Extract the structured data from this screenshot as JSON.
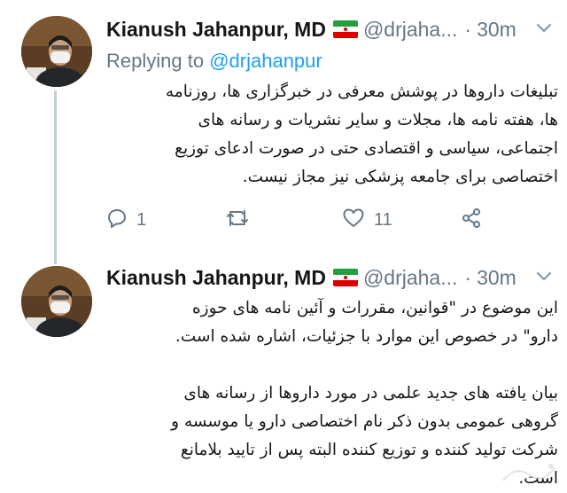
{
  "tweets": [
    {
      "author": {
        "name": "Kianush Jahanpur, MD",
        "handle": "@drjaha...",
        "flag": "iran-flag"
      },
      "time": "30m",
      "reply_label": "Replying to",
      "reply_mention": "@drjahanpur",
      "lines": [
        "تبلیغات داروها در پوشش معرفی در خبرگزاری ها، روزنامه",
        "ها، هفته نامه ها، مجلات و سایر نشریات و رسانه های",
        "اجتماعی، سیاسی و اقتصادی حتی در صورت ادعای توزیع",
        "اختصاصی برای جامعه پزشکی نیز مجاز نیست."
      ],
      "actions": {
        "reply_count": "1",
        "retweet_count": "",
        "like_count": "11"
      }
    },
    {
      "author": {
        "name": "Kianush Jahanpur, MD",
        "handle": "@drjaha...",
        "flag": "iran-flag"
      },
      "time": "30m",
      "para1": [
        "این موضوع در \"قوانین، مقررات و آئین نامه های حوزه",
        "دارو\" در خصوص این موارد با جزئیات، اشاره شده است."
      ],
      "para2": [
        "بیان یافته های جدید علمی در مورد داروها از رسانه های",
        "گروهی عمومی بدون ذکر نام اختصاصی دارو یا موسسه و",
        "شرکت تولید کننده و توزیع کننده البته  پس از تایید بلامانع",
        "است."
      ]
    }
  ],
  "icons": {
    "reply": "reply-icon",
    "retweet": "retweet-icon",
    "like": "heart-icon",
    "share": "share-icon",
    "more": "chevron-down-icon"
  },
  "colors": {
    "link": "#1da1f2",
    "secondary_text": "#657786",
    "thread_line": "#c4cfd6"
  }
}
